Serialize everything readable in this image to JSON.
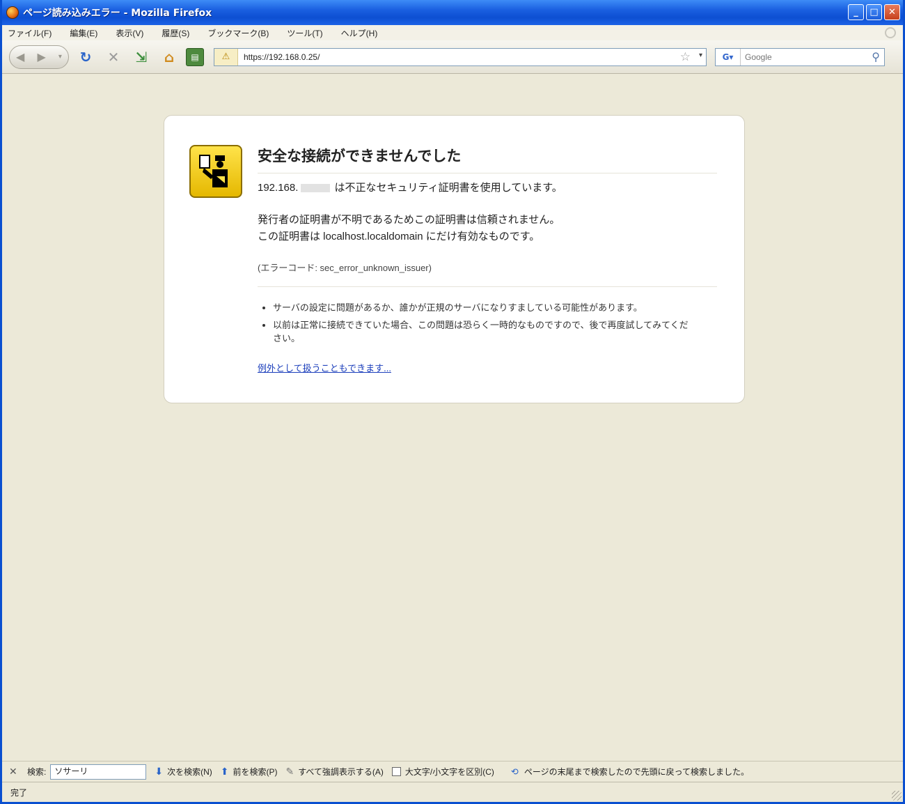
{
  "window": {
    "title": "ページ読み込みエラー - Mozilla Firefox",
    "controls": {
      "minimize": "_",
      "maximize": "□",
      "close": "✕"
    }
  },
  "menu": {
    "items": [
      "ファイル(F)",
      "編集(E)",
      "表示(V)",
      "履歴(S)",
      "ブックマーク(B)",
      "ツール(T)",
      "ヘルプ(H)"
    ]
  },
  "navbar": {
    "url": "https://192.168.0.25/",
    "search_placeholder": "Google",
    "icons": [
      "back-icon",
      "forward-icon",
      "reload-icon",
      "stop-icon",
      "bookmark-add-icon",
      "home-icon",
      "page-icon",
      "warning-icon",
      "star-icon",
      "search-icon"
    ]
  },
  "error": {
    "title": "安全な接続ができませんでした",
    "host_prefix": "192.168.",
    "line1_suffix": " は不正なセキュリティ証明書を使用しています。",
    "line2a": "発行者の証明書が不明であるためこの証明書は信頼されません。",
    "line2b": "この証明書は localhost.localdomain にだけ有効なものです。",
    "code": "(エラーコード: sec_error_unknown_issuer)",
    "bullets": [
      "サーバの設定に問題があるか、誰かが正規のサーバになりすましている可能性があります。",
      "以前は正常に接続できていた場合、この問題は恐らく一時的なものですので、後で再度試してみてください。"
    ],
    "exception_link": "例外として扱うこともできます..."
  },
  "findbar": {
    "close": "✕",
    "label": "検索:",
    "value": "ソサーリ",
    "next": "次を検索(N)",
    "previous": "前を検索(P)",
    "highlight": "すべて強調表示する(A)",
    "match_case": "大文字/小文字を区別(C)",
    "status": "ページの末尾まで検索したので先頭に戻って検索しました。"
  },
  "statusbar": {
    "text": "完了"
  },
  "colors": {
    "titlebar": "#0d4fd2",
    "chrome": "#ece9d8",
    "link": "#1a3dbb",
    "warning_icon": "#ffe34a"
  }
}
